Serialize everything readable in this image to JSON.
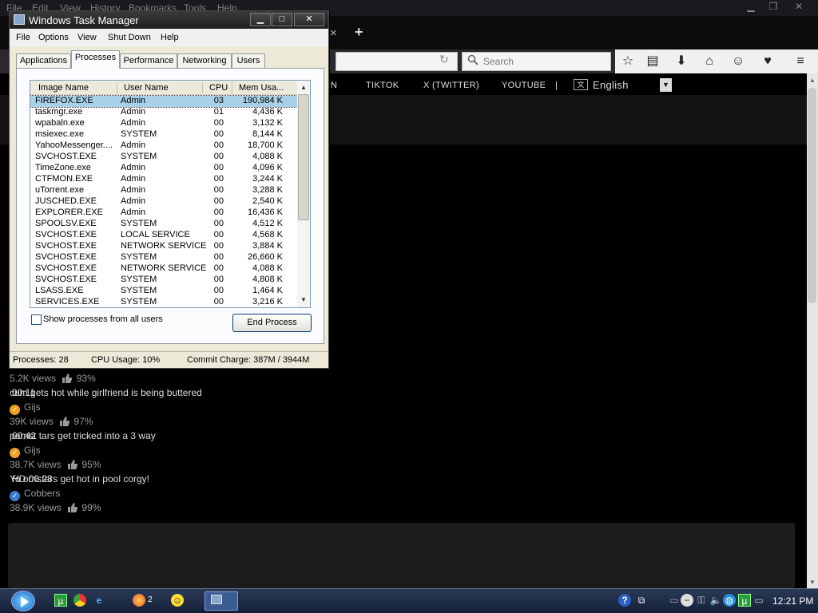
{
  "browser": {
    "menu": [
      "File",
      "Edit",
      "View",
      "History",
      "Bookmarks",
      "Tools",
      "Help"
    ],
    "search_placeholder": "Search",
    "new_tab_symbol": "+",
    "close_tab_symbol": "×"
  },
  "site": {
    "nav": [
      "N",
      "TIKTOK",
      "X (TWITTER)",
      "YOUTUBE",
      "|"
    ],
    "language": "English"
  },
  "videos": [
    {
      "views": "5.2K views",
      "rating": "93%",
      "title": "gets hot while girlfriend is being buttered",
      "title_prefix": "cum",
      "duration": "00:11",
      "author": "Gijs",
      "author_color": "#f0a020",
      "author_badge": "✓"
    },
    {
      "views": "39K views",
      "rating": "97%",
      "title": "tars get tricked into a 3 way",
      "title_prefix": "pornst",
      "duration": "00:42",
      "author": "Gijs",
      "author_color": "#f0a020",
      "author_badge": "✓"
    },
    {
      "views": "38.7K views",
      "rating": "95%",
      "title": "ornstars get hot in pool corgy!",
      "title_prefix": "Yo",
      "duration": "HD 00:23",
      "author": "Cobbers",
      "author_color": "#3a7bd5",
      "author_badge": "✓"
    },
    {
      "views": "38.9K views",
      "rating": "99%"
    }
  ],
  "taskmgr": {
    "title": "Windows Task Manager",
    "menu": [
      "File",
      "Options",
      "View",
      "Shut Down",
      "Help"
    ],
    "tabs": [
      "Applications",
      "Processes",
      "Performance",
      "Networking",
      "Users"
    ],
    "active_tab": "Processes",
    "columns": [
      "Image Name",
      "User Name",
      "CPU",
      "Mem Usa..."
    ],
    "rows": [
      {
        "name": "FIREFOX.EXE",
        "user": "Admin",
        "cpu": "03",
        "mem": "190,984 K"
      },
      {
        "name": "taskmgr.exe",
        "user": "Admin",
        "cpu": "01",
        "mem": "4,436 K"
      },
      {
        "name": "wpabaln.exe",
        "user": "Admin",
        "cpu": "00",
        "mem": "3,132 K"
      },
      {
        "name": "msiexec.exe",
        "user": "SYSTEM",
        "cpu": "00",
        "mem": "8,144 K"
      },
      {
        "name": "YahooMessenger....",
        "user": "Admin",
        "cpu": "00",
        "mem": "18,700 K"
      },
      {
        "name": "SVCHOST.EXE",
        "user": "SYSTEM",
        "cpu": "00",
        "mem": "4,088 K"
      },
      {
        "name": "TimeZone.exe",
        "user": "Admin",
        "cpu": "00",
        "mem": "4,096 K"
      },
      {
        "name": "CTFMON.EXE",
        "user": "Admin",
        "cpu": "00",
        "mem": "3,244 K"
      },
      {
        "name": "uTorrent.exe",
        "user": "Admin",
        "cpu": "00",
        "mem": "3,288 K"
      },
      {
        "name": "JUSCHED.EXE",
        "user": "Admin",
        "cpu": "00",
        "mem": "2,540 K"
      },
      {
        "name": "EXPLORER.EXE",
        "user": "Admin",
        "cpu": "00",
        "mem": "16,436 K"
      },
      {
        "name": "SPOOLSV.EXE",
        "user": "SYSTEM",
        "cpu": "00",
        "mem": "4,512 K"
      },
      {
        "name": "SVCHOST.EXE",
        "user": "LOCAL SERVICE",
        "cpu": "00",
        "mem": "4,568 K"
      },
      {
        "name": "SVCHOST.EXE",
        "user": "NETWORK SERVICE",
        "cpu": "00",
        "mem": "3,884 K"
      },
      {
        "name": "SVCHOST.EXE",
        "user": "SYSTEM",
        "cpu": "00",
        "mem": "26,660 K"
      },
      {
        "name": "SVCHOST.EXE",
        "user": "NETWORK SERVICE",
        "cpu": "00",
        "mem": "4,088 K"
      },
      {
        "name": "SVCHOST.EXE",
        "user": "SYSTEM",
        "cpu": "00",
        "mem": "4,808 K"
      },
      {
        "name": "LSASS.EXE",
        "user": "SYSTEM",
        "cpu": "00",
        "mem": "1,464 K"
      },
      {
        "name": "SERVICES.EXE",
        "user": "SYSTEM",
        "cpu": "00",
        "mem": "3,216 K"
      }
    ],
    "show_all_label": "Show processes from all users",
    "end_process_label": "End Process",
    "status": {
      "processes": "Processes: 28",
      "cpu": "CPU Usage: 10%",
      "commit": "Commit Charge: 387M / 3944M"
    }
  },
  "taskbar": {
    "clock": "12:21 PM",
    "firefox_count": "2"
  }
}
